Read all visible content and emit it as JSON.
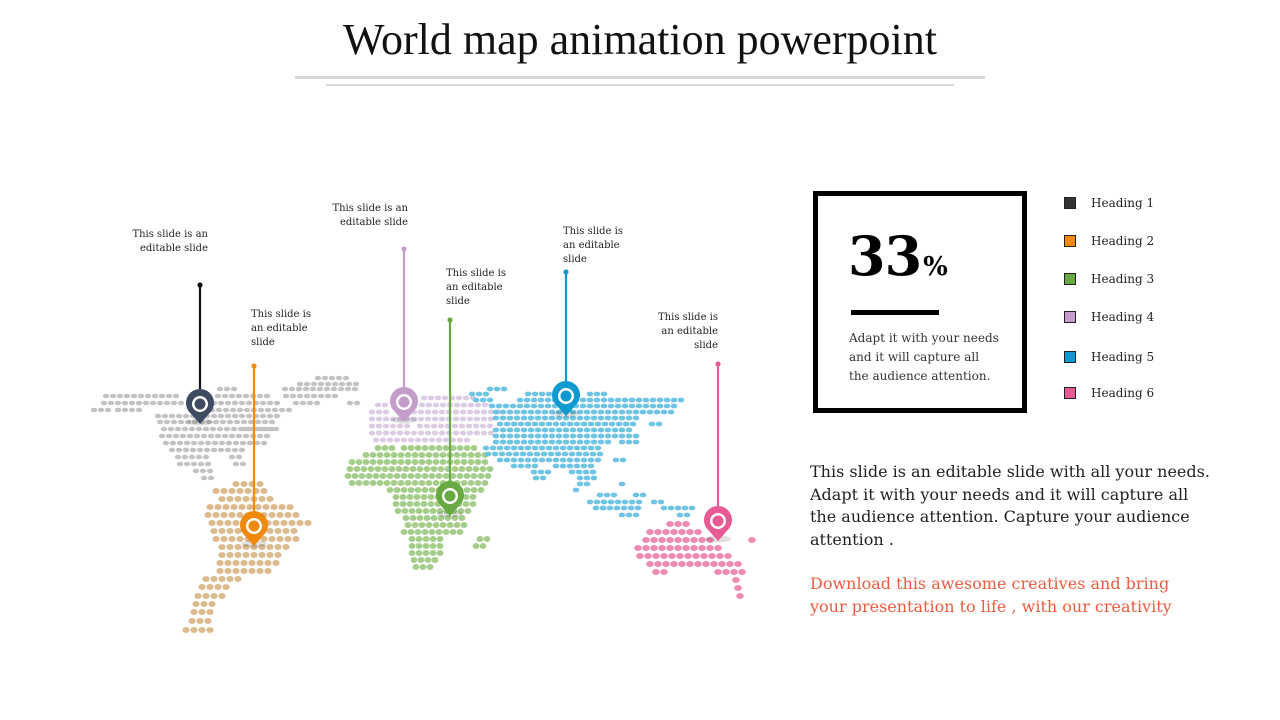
{
  "slide": {
    "title": "World map animation powerpoint"
  },
  "colors": {
    "north_america": "#c3c3c3",
    "south_america": "#dcba8f",
    "europe": "#dccbe4",
    "africa": "#a5cd8a",
    "asia": "#6ec4e2",
    "australia": "#ee8db4",
    "pin_1": "#3f4b62",
    "pin_2": "#f08a0c",
    "pin_3": "#68a944",
    "pin_4": "#c49dcb",
    "pin_5": "#0f9ad1",
    "pin_6": "#e85a93",
    "promo_text": "#ec5b3f"
  },
  "callouts": [
    {
      "id": "north-america",
      "text": "This slide is an editable slide",
      "region": "North America",
      "pin_color": "#3f4b62",
      "line_color": "#111111"
    },
    {
      "id": "south-america",
      "text": "This slide is an editable slide",
      "region": "South America",
      "pin_color": "#f08a0c",
      "line_color": "#f08a0c"
    },
    {
      "id": "europe",
      "text": "This slide is an editable slide",
      "region": "Europe",
      "pin_color": "#c49dcb",
      "line_color": "#c49dcb"
    },
    {
      "id": "africa",
      "text": "This slide is an editable slide",
      "region": "Africa",
      "pin_color": "#68a944",
      "line_color": "#68a944"
    },
    {
      "id": "asia",
      "text": "This slide is an editable slide",
      "region": "Asia",
      "pin_color": "#0f9ad1",
      "line_color": "#0f9ad1"
    },
    {
      "id": "australia",
      "text": "This slide is an editable slide",
      "region": "Australia",
      "pin_color": "#e85a93",
      "line_color": "#e85a93"
    }
  ],
  "stat": {
    "value": "33",
    "unit": "%",
    "description": "Adapt it with your needs and it will capture all the audience attention."
  },
  "legend": [
    {
      "label": "Heading 1",
      "color": "#333333"
    },
    {
      "label": "Heading 2",
      "color": "#f08a0c"
    },
    {
      "label": "Heading 3",
      "color": "#68a944"
    },
    {
      "label": "Heading 4",
      "color": "#c49dcb"
    },
    {
      "label": "Heading 5",
      "color": "#0f9ad1"
    },
    {
      "label": "Heading 6",
      "color": "#e85a93"
    }
  ],
  "body_text": "This slide is an editable slide with all your needs. Adapt it with your needs and it will capture all the audience attention. Capture your audience attention .",
  "promo_text": "Download this awesome creatives and bring your presentation to life , with our creativity"
}
